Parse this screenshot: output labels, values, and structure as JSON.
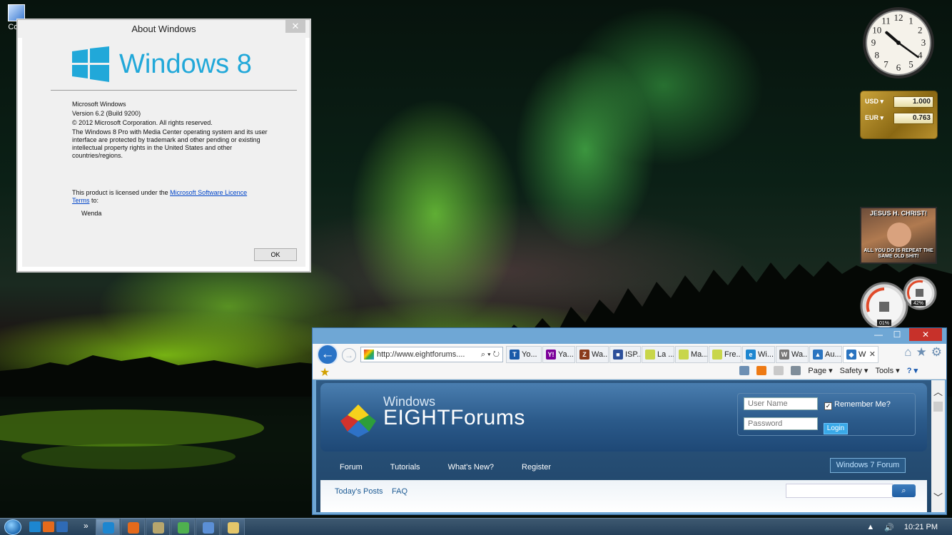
{
  "desktop": {
    "icon_label": "Com"
  },
  "about_dialog": {
    "title": "About Windows",
    "close_glyph": "✕",
    "brand": "Windows 8",
    "product": "Microsoft Windows",
    "version": "Version 6.2 (Build 9200)",
    "copyright": "© 2012 Microsoft Corporation. All rights reserved.",
    "legal": "The Windows 8 Pro with Media Center operating system and its user interface are protected by trademark and other pending or existing intellectual property rights in the United States and other countries/regions.",
    "license_prefix": "This product is licensed under the ",
    "license_link": "Microsoft Software Licence Terms",
    "license_suffix": " to:",
    "licensee": "Wenda",
    "ok_label": "OK",
    "logo_color": "#21a8d9"
  },
  "gadgets": {
    "clock": {
      "numerals": [
        "12",
        "1",
        "2",
        "3",
        "4",
        "5",
        "6",
        "7",
        "8",
        "9",
        "10",
        "11"
      ],
      "hour": 10,
      "minute": 21
    },
    "currency": {
      "rows": [
        {
          "code": "USD ▾",
          "value": "1.000"
        },
        {
          "code": "EUR ▾",
          "value": "0.763"
        }
      ]
    },
    "picture": {
      "caption_top": "JESUS H. CHRIST!",
      "caption_bottom": "ALL YOU DO IS REPEAT THE SAME OLD SHIT!"
    },
    "meter": {
      "cpu": "01%",
      "ram": "42%",
      "cpu_fraction": 0.01,
      "ram_fraction": 0.42
    }
  },
  "ie": {
    "min_glyph": "—",
    "max_glyph": "☐",
    "close_glyph": "✕",
    "back_glyph": "←",
    "fwd_glyph": "→",
    "address": "http://www.eightforums....",
    "address_actions": "⌕ ▾ ↻",
    "tabs": [
      {
        "label": "Yo...",
        "icon_color": "#1a5aa8",
        "icon_text": "T"
      },
      {
        "label": "Ya...",
        "icon_color": "#7b0099",
        "icon_text": "Y!"
      },
      {
        "label": "Wa...",
        "icon_color": "#8a3b1b",
        "icon_text": "Z"
      },
      {
        "label": "ISP...",
        "icon_color": "#2c4f9a",
        "icon_text": "■"
      },
      {
        "label": "La ...",
        "icon_color": "#c8d64a",
        "icon_text": ""
      },
      {
        "label": "Ma...",
        "icon_color": "#c8d64a",
        "icon_text": ""
      },
      {
        "label": "Fre...",
        "icon_color": "#c8d64a",
        "icon_text": ""
      },
      {
        "label": "Wi...",
        "icon_color": "#1d86d0",
        "icon_text": "e"
      },
      {
        "label": "Wa...",
        "icon_color": "#777777",
        "icon_text": "W"
      },
      {
        "label": "Au...",
        "icon_color": "#2a74c0",
        "icon_text": "▲"
      },
      {
        "label": "W",
        "icon_color": "#2a74c0",
        "icon_text": "◆"
      }
    ],
    "active_tab_close": "✕",
    "right_buttons": [
      "⌂",
      "★",
      "⚙"
    ],
    "command_bar": {
      "favorites_glyph": "★",
      "page_label": "Page ▾",
      "safety_label": "Safety ▾",
      "tools_label": "Tools ▾",
      "help_label": "? ▾"
    },
    "forum": {
      "logo_top": "Windows",
      "logo_main": "EIGHTForums",
      "username_placeholder": "User Name",
      "password_placeholder": "Password",
      "remember_check": "✓",
      "remember_label": "Remember Me?",
      "login_label": "Login",
      "nav": [
        "Forum",
        "Tutorials",
        "What's New?",
        "Register"
      ],
      "w7_label": "Windows 7 Forum",
      "sub_nav": [
        "Today's Posts",
        "FAQ"
      ],
      "search_glyph": "⌕"
    }
  },
  "taskbar": {
    "chevron": "»",
    "tray_arrow": "▲",
    "volume_glyph": "🔊",
    "time": "10:21 PM",
    "buttons": [
      {
        "color": "#1d86d0",
        "active": true
      },
      {
        "color": "#e46a1c",
        "active": false
      },
      {
        "color": "#b7a66d",
        "active": false
      },
      {
        "color": "#4fb04f",
        "active": false
      },
      {
        "color": "#5b8fd6",
        "active": false
      },
      {
        "color": "#e4c66a",
        "active": false
      }
    ]
  }
}
